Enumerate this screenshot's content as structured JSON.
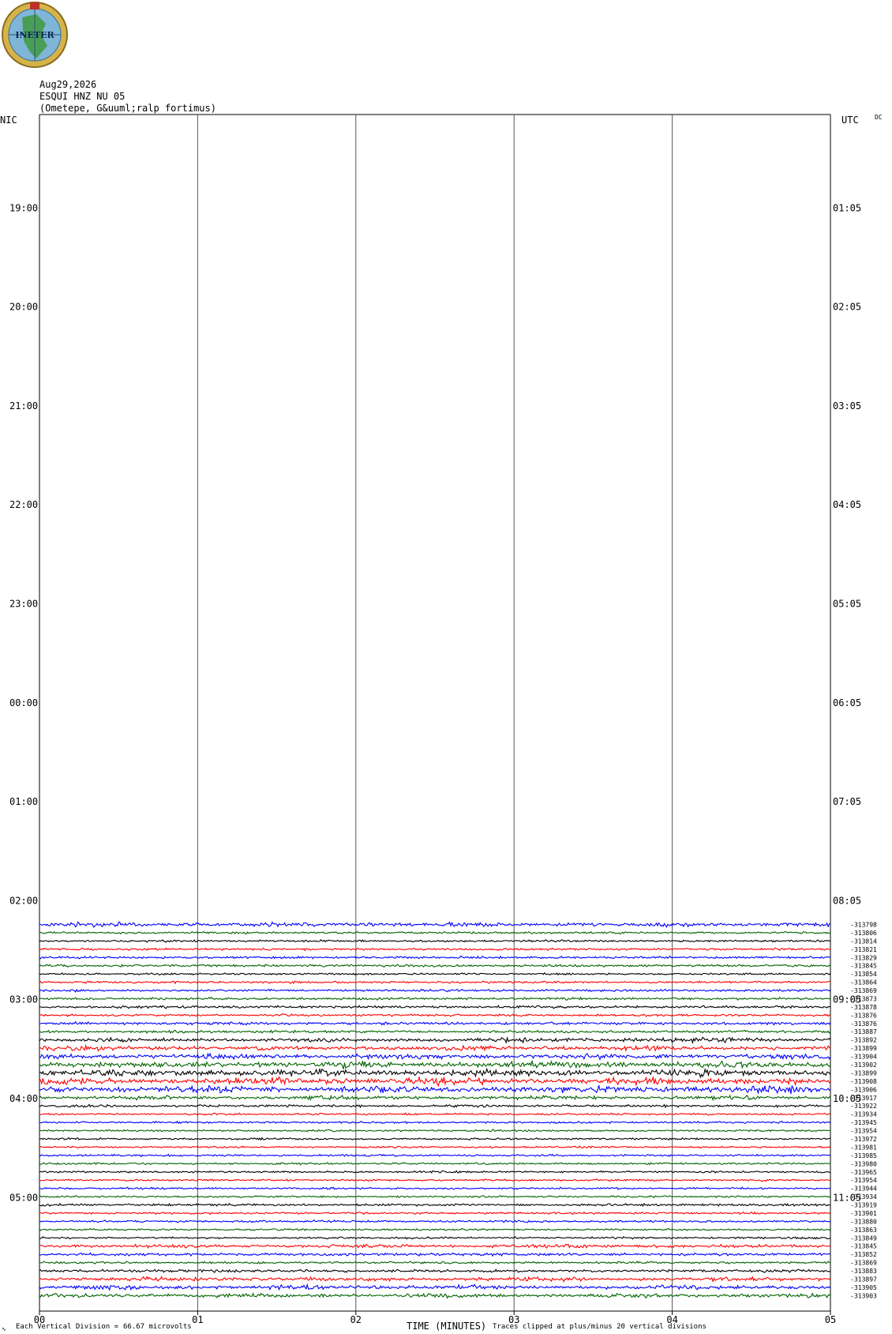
{
  "logo": {
    "text": "INETER",
    "colors": {
      "ring": "#d6b34a",
      "globe": "#7fb6d8",
      "land": "#3f9a3f",
      "flag": "#c0302b"
    }
  },
  "header": {
    "date": "Aug29,2026",
    "station": "ESQUI HNZ NU 05",
    "location": "(Ometepe, G&uuml;ralp fortimus)"
  },
  "axes": {
    "left_title": "NIC",
    "right_title": "UTC",
    "right_corner": "DC",
    "left_hours": [
      "19:00",
      "20:00",
      "21:00",
      "22:00",
      "23:00",
      "00:00",
      "01:00",
      "02:00",
      "03:00",
      "04:00",
      "05:00"
    ],
    "right_hours": [
      "01:05",
      "02:05",
      "03:05",
      "04:05",
      "05:05",
      "06:05",
      "07:05",
      "08:05",
      "09:05",
      "10:05",
      "11:05"
    ],
    "x_ticks": [
      "00",
      "01",
      "02",
      "03",
      "04",
      "05"
    ],
    "x_label": "TIME (MINUTES)"
  },
  "footer": {
    "scale_label": "Each Vertical Division =",
    "scale_value": "66.67 microvolts",
    "clip_note": "Traces clipped at plus/minus 20 vertical divisions"
  },
  "colors": {
    "trace_cycle": [
      "#0000ff",
      "#006400",
      "#000000",
      "#ff0000"
    ]
  },
  "chart_data": {
    "type": "line",
    "x_unit": "minutes",
    "x_range": [
      0,
      5
    ],
    "rows_per_hour": 12,
    "first_trace_time_nic": "02:05",
    "trace_labels": [
      "-313798",
      "-313806",
      "-313814",
      "-313821",
      "-313829",
      "-313845",
      "-313854",
      "-313864",
      "-313869",
      "-313873",
      "-313878",
      "-313876",
      "-313876",
      "-313887",
      "-313892",
      "-313899",
      "-313904",
      "-313902",
      "-313899",
      "-313908",
      "-313906",
      "-313917",
      "-313922",
      "-313934",
      "-313945",
      "-313954",
      "-313972",
      "-313981",
      "-313985",
      "-313980",
      "-313965",
      "-313954",
      "-313944",
      "-313934",
      "-313919",
      "-313901",
      "-313880",
      "-313863",
      "-313849",
      "-313845",
      "-313852",
      "-313869",
      "-313883",
      "-313897",
      "-313905",
      "-313903"
    ],
    "trace_activity": [
      1.6,
      1.0,
      1.0,
      1.1,
      1.1,
      1.2,
      0.9,
      1.0,
      1.1,
      1.1,
      1.2,
      1.1,
      1.3,
      1.2,
      1.6,
      1.8,
      2.0,
      2.4,
      2.6,
      2.6,
      2.6,
      1.5,
      1.2,
      0.9,
      0.9,
      0.9,
      0.9,
      0.9,
      0.9,
      0.9,
      0.9,
      0.9,
      0.9,
      0.9,
      1.1,
      1.0,
      1.0,
      0.9,
      0.9,
      1.4,
      1.3,
      1.1,
      1.3,
      1.5,
      1.6,
      1.5
    ]
  }
}
